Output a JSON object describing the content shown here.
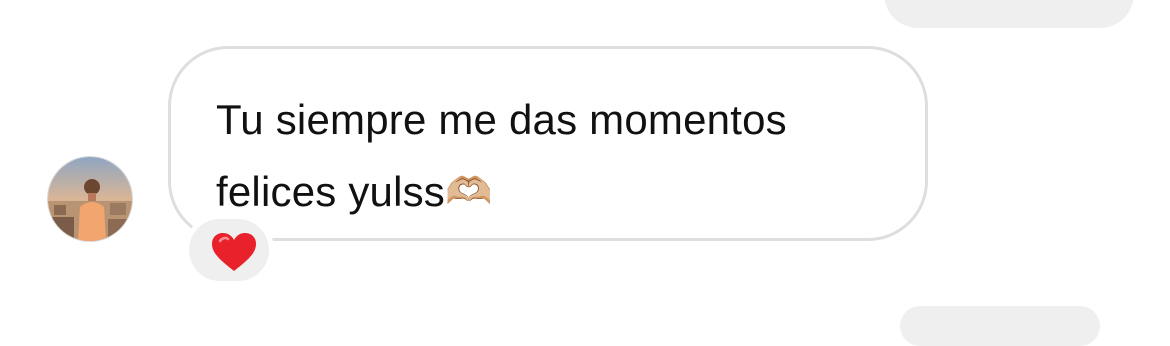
{
  "thread": {
    "message": {
      "text": "Tu siempre me das momentos felices yulss",
      "emoji": "🫶🏼",
      "reaction": "heart"
    }
  }
}
